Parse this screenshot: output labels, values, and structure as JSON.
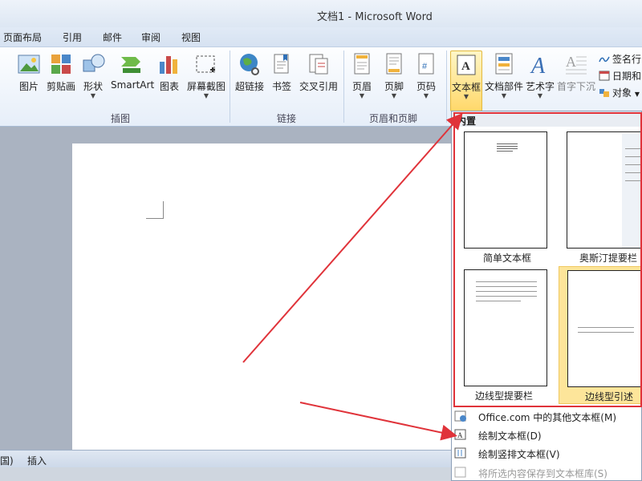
{
  "window": {
    "title": "文档1  -  Microsoft Word"
  },
  "menu_tabs": [
    "页面布局",
    "引用",
    "邮件",
    "审阅",
    "视图"
  ],
  "ribbon": {
    "buttons": [
      "图片",
      "剪贴画",
      "形状",
      "SmartArt",
      "图表",
      "屏幕截图",
      "超链接",
      "书签",
      "交叉引用",
      "页眉",
      "页脚",
      "页码",
      "文本框",
      "文档部件",
      "艺术字",
      "首字下沉"
    ],
    "small_buttons": [
      "签名行",
      "日期和",
      "对象"
    ],
    "groups": [
      "插图",
      "链接",
      "页眉和页脚"
    ]
  },
  "gallery": {
    "header": "内置",
    "items": [
      "简单文本框",
      "奥斯汀提要栏",
      "边线型提要栏",
      "边线型引述"
    ]
  },
  "dropdown_items": [
    "Office.com 中的其他文本框(M)",
    "绘制文本框(D)",
    "绘制竖排文本框(V)",
    "将所选内容保存到文本框库(S)"
  ],
  "statusbar": {
    "left": "国)",
    "mode": "插入"
  },
  "colors": {
    "accent": "#e0333a",
    "selected": "#fde59a",
    "ribbon": "#e6eef9"
  }
}
